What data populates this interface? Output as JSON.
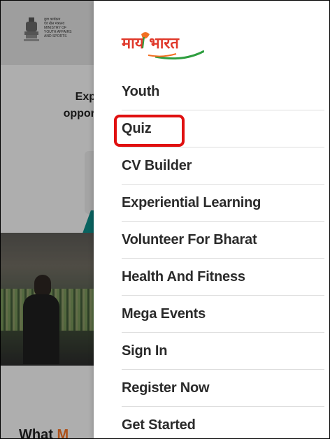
{
  "ministry": {
    "lines": [
      "युवा कार्यक्रम",
      "एवं खेल मंत्रालय",
      "MINISTRY OF",
      "YOUTH AFFAIRS",
      "AND SPORTS"
    ]
  },
  "background": {
    "hero_line1": "Exp",
    "hero_line2": "opportu",
    "footer_text_a": "What ",
    "footer_text_b": "M"
  },
  "drawer": {
    "logo_text": "माय भारत",
    "menu_items": [
      "Youth",
      "Quiz",
      "CV Builder",
      "Experiential Learning",
      "Volunteer For Bharat",
      "Health And Fitness",
      "Mega Events",
      "Sign In",
      "Register Now",
      "Get Started"
    ]
  },
  "colors": {
    "highlight": "#e01010",
    "logo_orange": "#f26f21",
    "logo_green": "#2e9e3f",
    "teal": "#0e8a86"
  }
}
